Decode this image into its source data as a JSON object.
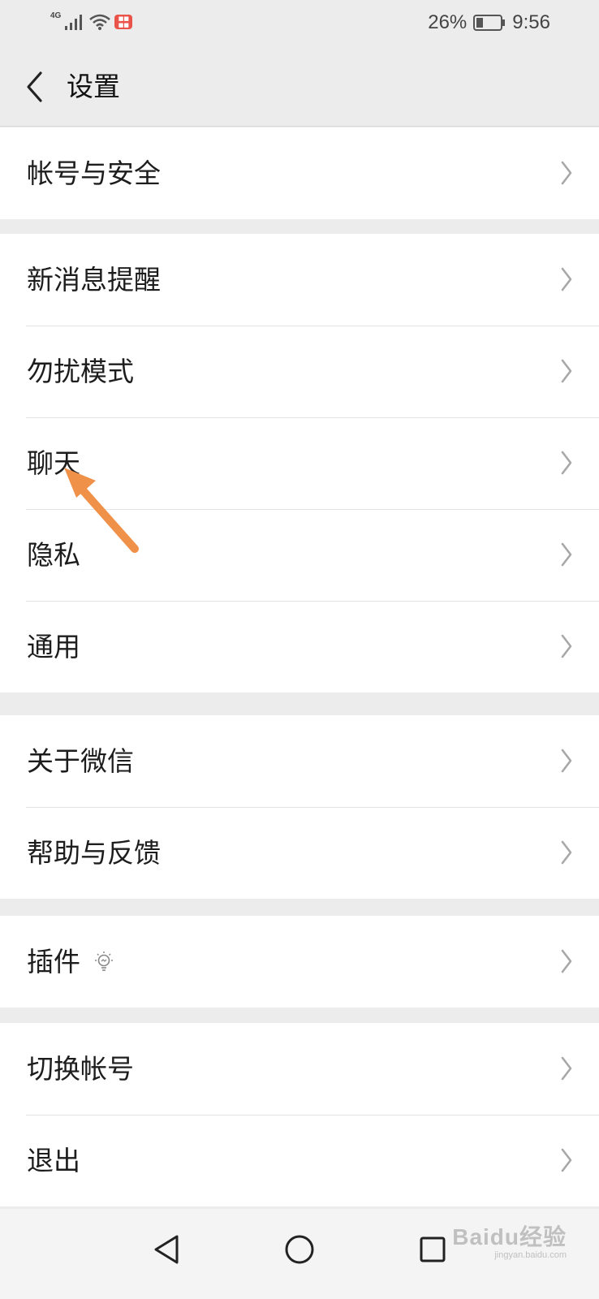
{
  "status_bar": {
    "network": "4G",
    "battery": "26%",
    "time": "9:56"
  },
  "header": {
    "title": "设置"
  },
  "groups": [
    {
      "items": [
        {
          "label": "帐号与安全"
        }
      ]
    },
    {
      "items": [
        {
          "label": "新消息提醒"
        },
        {
          "label": "勿扰模式"
        },
        {
          "label": "聊天"
        },
        {
          "label": "隐私"
        },
        {
          "label": "通用"
        }
      ]
    },
    {
      "items": [
        {
          "label": "关于微信"
        },
        {
          "label": "帮助与反馈"
        }
      ]
    },
    {
      "items": [
        {
          "label": "插件"
        }
      ]
    },
    {
      "items": [
        {
          "label": "切换帐号"
        },
        {
          "label": "退出"
        }
      ]
    }
  ],
  "watermark": {
    "brand": "Baidu经验",
    "url": "jingyan.baidu.com"
  },
  "colors": {
    "background": "#ececec",
    "annotation_arrow": "#f0914a"
  }
}
